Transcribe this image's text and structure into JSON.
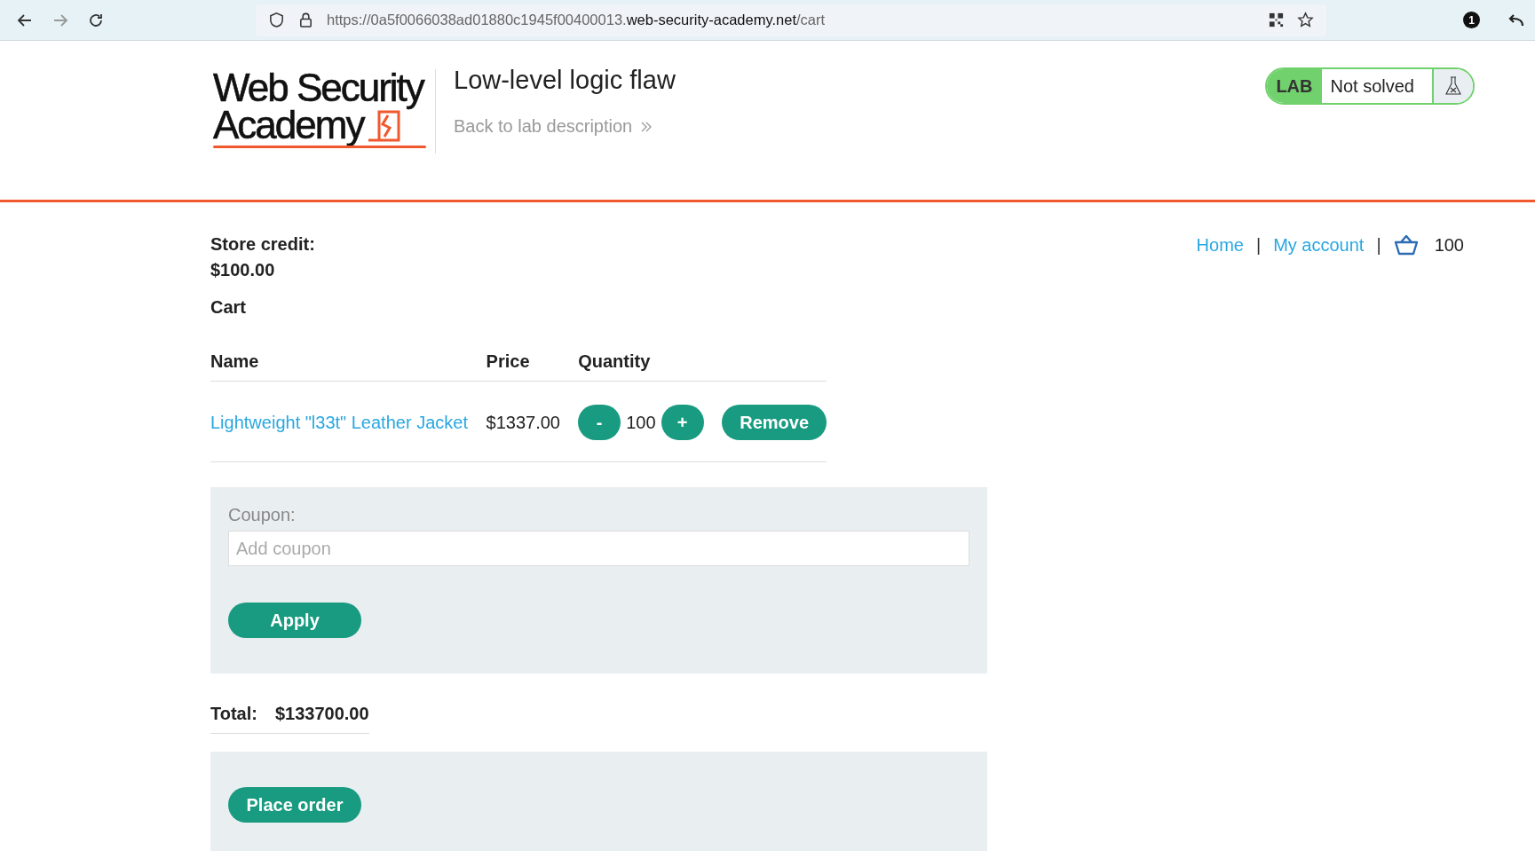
{
  "browser": {
    "url": {
      "start": "https://0a5f0066038ad01880c1945f00400013.",
      "host": "web-security-academy.net",
      "end": "/cart"
    },
    "badge": "1"
  },
  "header": {
    "logo": {
      "line_1": "Web Security",
      "line_2": "Academy"
    },
    "title": "Low-level logic flaw",
    "back_link": "Back to lab description",
    "lab_label": "LAB",
    "lab_status": "Not solved"
  },
  "nav": {
    "links": [
      {
        "label": "Home",
        "separator": "|"
      },
      {
        "label": "My account",
        "separator": "|"
      }
    ],
    "cart_count": "100"
  },
  "store_credit": {
    "label": "Store credit:",
    "value": "$100.00"
  },
  "cart": {
    "heading": "Cart",
    "columns": [
      "Name",
      "Price",
      "Quantity"
    ],
    "rows": [
      {
        "name": "Lightweight \"l33t\" Leather Jacket",
        "price": "$1337.00",
        "decrease": "-",
        "quantity": "100",
        "increase": "+",
        "remove": "Remove"
      }
    ]
  },
  "coupon": {
    "label": "Coupon:",
    "placeholder": "Add coupon",
    "button": "Apply"
  },
  "total": {
    "label": "Total:",
    "value": "$133700.00"
  },
  "order": {
    "button": "Place order"
  }
}
